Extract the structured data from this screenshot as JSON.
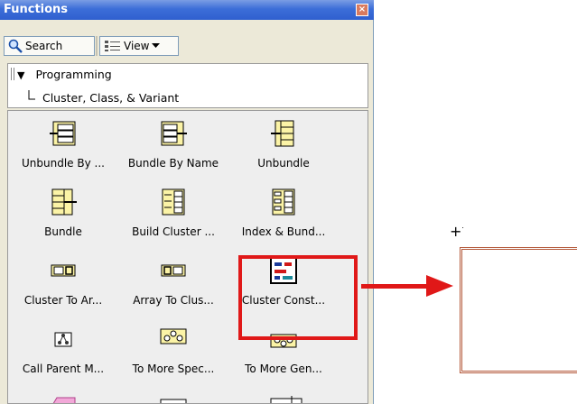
{
  "window": {
    "title": "Functions",
    "close_glyph": "×"
  },
  "toolbar": {
    "search_label": "Search",
    "view_label": "View"
  },
  "tree": {
    "expanded_glyph": "▼",
    "root_label": "Programming",
    "child_label": "Cluster, Class, & Variant"
  },
  "palette_items": [
    {
      "label": "Unbundle By ...",
      "icon": "unbundle-by-name-icon"
    },
    {
      "label": "Bundle By Name",
      "icon": "bundle-by-name-icon"
    },
    {
      "label": "Unbundle",
      "icon": "unbundle-icon"
    },
    {
      "label": "Bundle",
      "icon": "bundle-icon"
    },
    {
      "label": "Build Cluster ...",
      "icon": "build-cluster-array-icon"
    },
    {
      "label": "Index & Bund...",
      "icon": "index-bundle-cluster-array-icon"
    },
    {
      "label": "Cluster To Ar...",
      "icon": "cluster-to-array-icon"
    },
    {
      "label": "Array To Clus...",
      "icon": "array-to-cluster-icon"
    },
    {
      "label": "Cluster Const...",
      "icon": "cluster-constant-icon"
    },
    {
      "label": "Call Parent M...",
      "icon": "call-parent-method-icon"
    },
    {
      "label": "To More Spec...",
      "icon": "to-more-specific-class-icon"
    },
    {
      "label": "To More Gen...",
      "icon": "to-more-generic-class-icon"
    }
  ],
  "colors": {
    "highlight": "#e01818",
    "cluster_border": "#b4593a",
    "titlebar": "#2f5fcf"
  }
}
